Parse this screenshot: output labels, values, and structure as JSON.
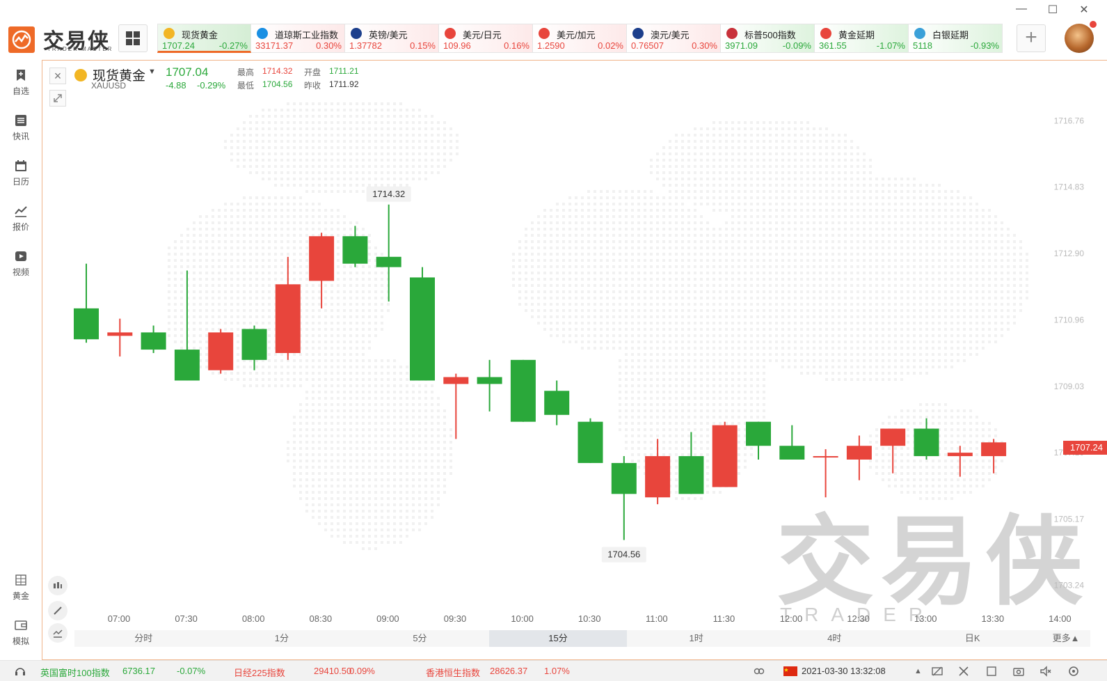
{
  "app": {
    "logo_text": "交易侠",
    "logo_sub": "TRADER MASTER"
  },
  "window": {
    "minimize": "—",
    "maximize": "☐",
    "close": "✕"
  },
  "tickers": [
    {
      "name": "现货黄金",
      "price": "1707.24",
      "change": "-0.27%",
      "dir": "down",
      "icon": "gold-coin-icon",
      "icon_color": "#f2b624"
    },
    {
      "name": "道琼斯工业指数",
      "price": "33171.37",
      "change": "0.30%",
      "dir": "up",
      "icon": "dow-jones-icon",
      "icon_color": "#1a8fe3"
    },
    {
      "name": "英镑/美元",
      "price": "1.37782",
      "change": "0.15%",
      "dir": "up",
      "icon": "uk-flag-icon",
      "icon_color": "#1d3f8c"
    },
    {
      "name": "美元/日元",
      "price": "109.96",
      "change": "0.16%",
      "dir": "up",
      "icon": "japan-flag-icon",
      "icon_color": "#e8453c"
    },
    {
      "name": "美元/加元",
      "price": "1.2590",
      "change": "0.02%",
      "dir": "up",
      "icon": "canada-flag-icon",
      "icon_color": "#e8453c"
    },
    {
      "name": "澳元/美元",
      "price": "0.76507",
      "change": "0.30%",
      "dir": "up",
      "icon": "australia-flag-icon",
      "icon_color": "#1d3f8c"
    },
    {
      "name": "标普500指数",
      "price": "3971.09",
      "change": "-0.09%",
      "dir": "down",
      "icon": "us-flag-icon",
      "icon_color": "#c8323a"
    },
    {
      "name": "黄金延期",
      "price": "361.55",
      "change": "-1.07%",
      "dir": "down",
      "icon": "td-gold-icon",
      "icon_color": "#e8453c"
    },
    {
      "name": "白银延期",
      "price": "5118",
      "change": "-0.93%",
      "dir": "down",
      "icon": "td-silver-icon",
      "icon_color": "#3aa0d8"
    }
  ],
  "sidebar": [
    {
      "label": "自选",
      "icon": "bookmark-plus-icon"
    },
    {
      "label": "快讯",
      "icon": "news-list-icon"
    },
    {
      "label": "日历",
      "icon": "calendar-icon"
    },
    {
      "label": "报价",
      "icon": "line-chart-icon"
    },
    {
      "label": "视频",
      "icon": "video-play-icon"
    },
    {
      "label": "黄金",
      "icon": "gold-bars-icon"
    },
    {
      "label": "模拟",
      "icon": "wallet-icon"
    }
  ],
  "symbol": {
    "name": "现货黄金",
    "code": "XAUUSD",
    "price": "1707.04",
    "change": "-4.88",
    "change_pct": "-0.29%",
    "high_label": "最高",
    "high": "1714.32",
    "open_label": "开盘",
    "open": "1711.21",
    "low_label": "最低",
    "low": "1704.56",
    "prev_label": "昨收",
    "prev": "1711.92"
  },
  "chart_data": {
    "type": "candlestick",
    "y_ticks": [
      1716.76,
      1714.83,
      1712.9,
      1710.96,
      1709.03,
      1707.1,
      1705.17,
      1703.24
    ],
    "ylim": [
      1702.3,
      1717.7
    ],
    "x_ticks": [
      "07:00",
      "07:30",
      "08:00",
      "08:30",
      "09:00",
      "09:30",
      "10:00",
      "10:30",
      "11:00",
      "11:30",
      "12:00",
      "12:30",
      "13:00",
      "13:30",
      "14:00"
    ],
    "candles": [
      {
        "o": 1711.3,
        "h": 1712.6,
        "l": 1710.3,
        "c": 1710.4
      },
      {
        "o": 1710.5,
        "h": 1711.0,
        "l": 1709.9,
        "c": 1710.6
      },
      {
        "o": 1710.6,
        "h": 1710.8,
        "l": 1710.0,
        "c": 1710.1
      },
      {
        "o": 1710.1,
        "h": 1712.4,
        "l": 1709.2,
        "c": 1709.2
      },
      {
        "o": 1709.5,
        "h": 1710.7,
        "l": 1709.4,
        "c": 1710.6
      },
      {
        "o": 1710.7,
        "h": 1710.8,
        "l": 1709.5,
        "c": 1709.8
      },
      {
        "o": 1710.0,
        "h": 1712.8,
        "l": 1709.8,
        "c": 1712.0
      },
      {
        "o": 1712.1,
        "h": 1713.5,
        "l": 1711.3,
        "c": 1713.4
      },
      {
        "o": 1713.4,
        "h": 1713.7,
        "l": 1712.5,
        "c": 1712.6
      },
      {
        "o": 1712.8,
        "h": 1714.32,
        "l": 1711.5,
        "c": 1712.5
      },
      {
        "o": 1712.2,
        "h": 1712.5,
        "l": 1709.2,
        "c": 1709.2
      },
      {
        "o": 1709.1,
        "h": 1709.4,
        "l": 1707.5,
        "c": 1709.3
      },
      {
        "o": 1709.3,
        "h": 1709.8,
        "l": 1708.3,
        "c": 1709.1
      },
      {
        "o": 1709.8,
        "h": 1709.8,
        "l": 1708.0,
        "c": 1708.0
      },
      {
        "o": 1708.9,
        "h": 1709.2,
        "l": 1707.9,
        "c": 1708.2
      },
      {
        "o": 1708.0,
        "h": 1708.1,
        "l": 1706.8,
        "c": 1706.8
      },
      {
        "o": 1706.8,
        "h": 1707.0,
        "l": 1704.56,
        "c": 1705.9
      },
      {
        "o": 1705.8,
        "h": 1707.5,
        "l": 1705.6,
        "c": 1707.0
      },
      {
        "o": 1707.0,
        "h": 1707.7,
        "l": 1705.9,
        "c": 1705.9
      },
      {
        "o": 1706.1,
        "h": 1708.0,
        "l": 1706.1,
        "c": 1707.9
      },
      {
        "o": 1708.0,
        "h": 1708.0,
        "l": 1706.9,
        "c": 1707.3
      },
      {
        "o": 1707.3,
        "h": 1707.9,
        "l": 1706.9,
        "c": 1706.9
      },
      {
        "o": 1707.0,
        "h": 1707.2,
        "l": 1705.8,
        "c": 1707.0
      },
      {
        "o": 1706.9,
        "h": 1707.6,
        "l": 1706.3,
        "c": 1707.3
      },
      {
        "o": 1707.3,
        "h": 1707.8,
        "l": 1706.5,
        "c": 1707.8
      },
      {
        "o": 1707.8,
        "h": 1708.1,
        "l": 1706.9,
        "c": 1707.0
      },
      {
        "o": 1707.0,
        "h": 1707.3,
        "l": 1706.4,
        "c": 1707.1
      },
      {
        "o": 1707.0,
        "h": 1707.5,
        "l": 1706.5,
        "c": 1707.4
      }
    ],
    "high_label": "1714.32",
    "low_label": "1704.56",
    "last_price": "1707.24",
    "up_color": "#e8453c",
    "down_color": "#2aa83a",
    "grid": false
  },
  "timeframes": {
    "items": [
      "分时",
      "1分",
      "5分",
      "15分",
      "1时",
      "4时",
      "日K"
    ],
    "active": "15分",
    "more": "更多▲"
  },
  "watermark": {
    "text": "交易侠",
    "sub": "TRADER MASTER"
  },
  "bottom": {
    "indices": [
      {
        "name": "英国富时100指数",
        "value": "6736.17",
        "change": "-0.07%",
        "dir": "down"
      },
      {
        "name": "日经225指数",
        "value": "29410.50",
        "change": "0.09%",
        "dir": "up"
      },
      {
        "name": "香港恒生指数",
        "value": "28626.37",
        "change": "1.07%",
        "dir": "up"
      }
    ],
    "datetime": "2021-03-30 13:32:08",
    "flag_icon": "china-flag-icon"
  }
}
